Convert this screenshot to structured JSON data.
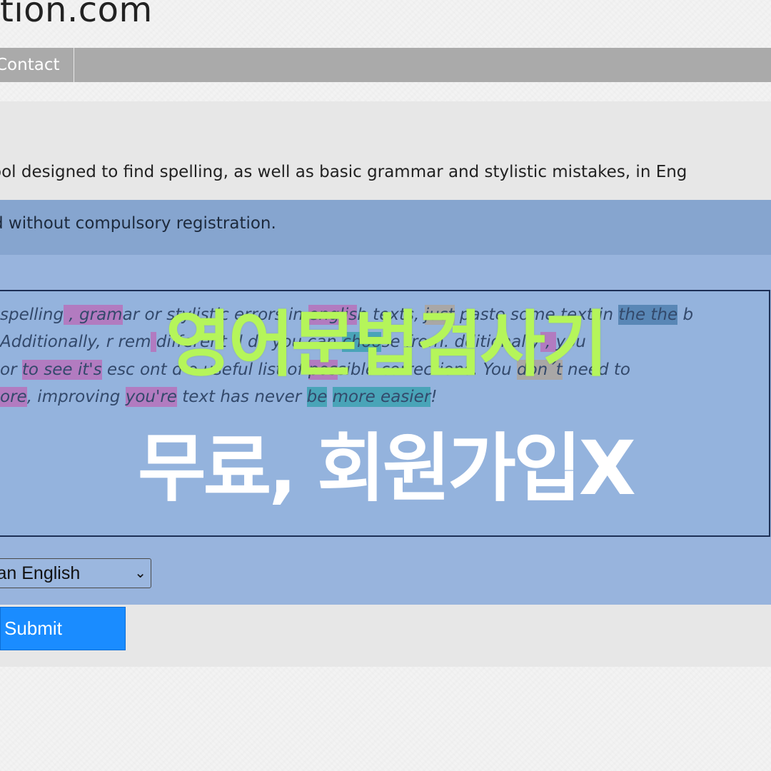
{
  "header": {
    "site_title": "tion.com"
  },
  "nav": {
    "items": [
      {
        "label": "Contact"
      }
    ]
  },
  "intro_text": "ool designed to find spelling, as well as basic grammar and stylistic mistakes, in Eng",
  "notice_text": "d without compulsory registration.",
  "editor": {
    "lines": [
      [
        {
          "t": "spelling"
        },
        {
          "t": " , ",
          "h": "p"
        },
        {
          "t": "gram",
          "h": "p"
        },
        {
          "t": "ar or stylistic errors in "
        },
        {
          "t": "englis",
          "h": "p"
        },
        {
          "t": "h texts, "
        },
        {
          "t": "just",
          "h": "g"
        },
        {
          "t": " paste some text in "
        },
        {
          "t": "the the",
          "h": "b"
        },
        {
          "t": " b"
        }
      ],
      [
        {
          "t": "Additionally, "
        },
        {
          "t": "     ",
          "h": "p"
        },
        {
          "t": "r rem"
        },
        {
          "t": "  ",
          "h": "p"
        },
        {
          "t": " different d  ds you can "
        },
        {
          "t": "choo",
          "h": "t"
        },
        {
          "t": "se from.  dditionally"
        },
        {
          "t": " , ",
          "h": "p"
        },
        {
          "t": "you"
        }
      ],
      [
        {
          "t": "or "
        },
        {
          "t": "to see it's",
          "h": "p"
        },
        {
          "t": "  esc  ont  d  o useful list of "
        },
        {
          "t": "pos",
          "h": "p"
        },
        {
          "t": "sible corrections. You "
        },
        {
          "t": "don´t",
          "h": "g"
        },
        {
          "t": " need to"
        }
      ],
      [
        {
          "t": "ore",
          "h": "p"
        },
        {
          "t": ", improving "
        },
        {
          "t": "you're",
          "h": "p"
        },
        {
          "t": " text has never "
        },
        {
          "t": "be",
          "h": "t"
        },
        {
          "t": " "
        },
        {
          "t": "more easier",
          "h": "t"
        },
        {
          "t": "!"
        }
      ]
    ]
  },
  "language_select": {
    "value": "can English"
  },
  "submit": {
    "label": "Submit"
  },
  "overlay": {
    "line1": "영어문법검사기",
    "line2": "무료, 회원가입X"
  },
  "colors": {
    "nav_bg": "#aaaaaa",
    "panel_bg": "#98b4dd",
    "submit_bg": "#1a8cff",
    "overlay_green": "#b5f55a",
    "highlight_purple": "#b27bc0",
    "highlight_teal": "#49a4b8"
  }
}
